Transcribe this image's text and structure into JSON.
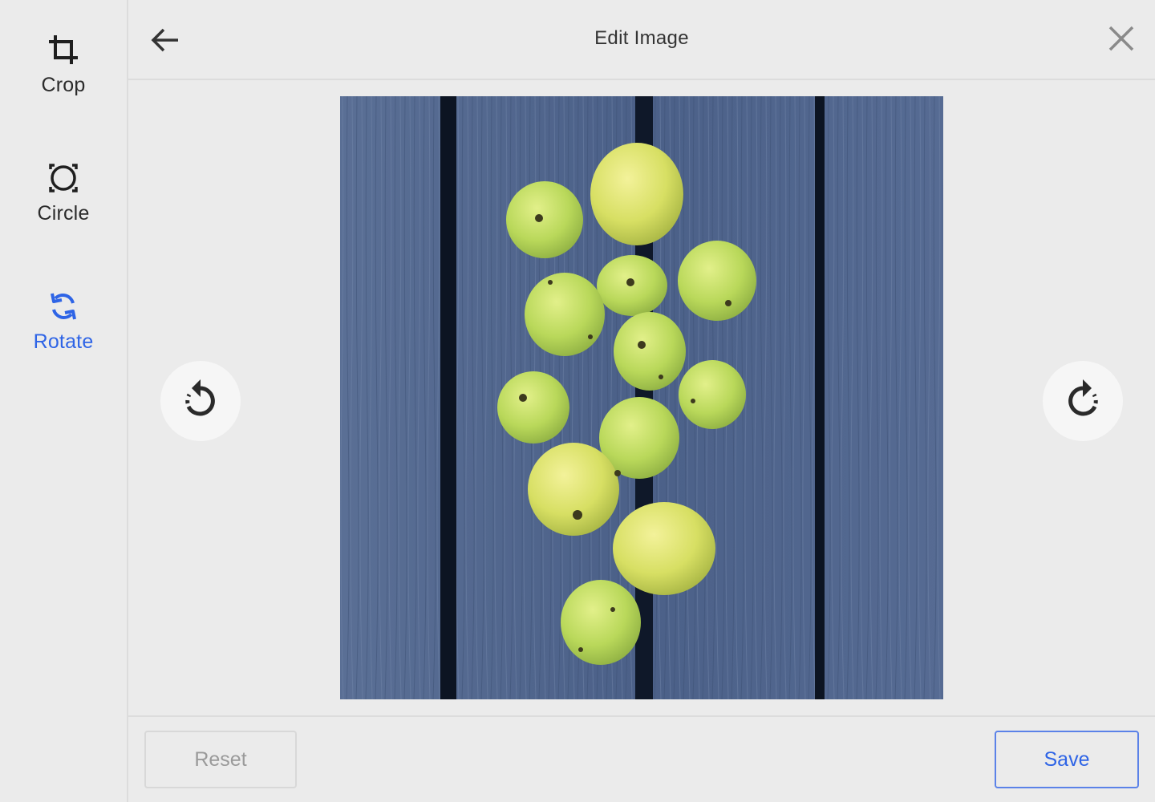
{
  "sidebar": {
    "items": [
      {
        "label": "Crop",
        "icon": "crop-icon",
        "active": false
      },
      {
        "label": "Circle",
        "icon": "circle-icon",
        "active": false
      },
      {
        "label": "Rotate",
        "icon": "rotate-icon",
        "active": true
      }
    ]
  },
  "header": {
    "title": "Edit Image",
    "back_icon": "arrow-left-icon",
    "close_icon": "close-icon"
  },
  "canvas": {
    "rotate_left_icon": "rotate-counterclockwise-icon",
    "rotate_right_icon": "rotate-clockwise-icon",
    "image_subject": "green apples on blue wooden planks"
  },
  "footer": {
    "reset_label": "Reset",
    "save_label": "Save"
  },
  "colors": {
    "accent": "#2e64e6",
    "background": "#ebebeb",
    "divider": "#dcdcdc",
    "disabled_text": "#9a9a9a",
    "icon_dark": "#2b2b2b"
  }
}
